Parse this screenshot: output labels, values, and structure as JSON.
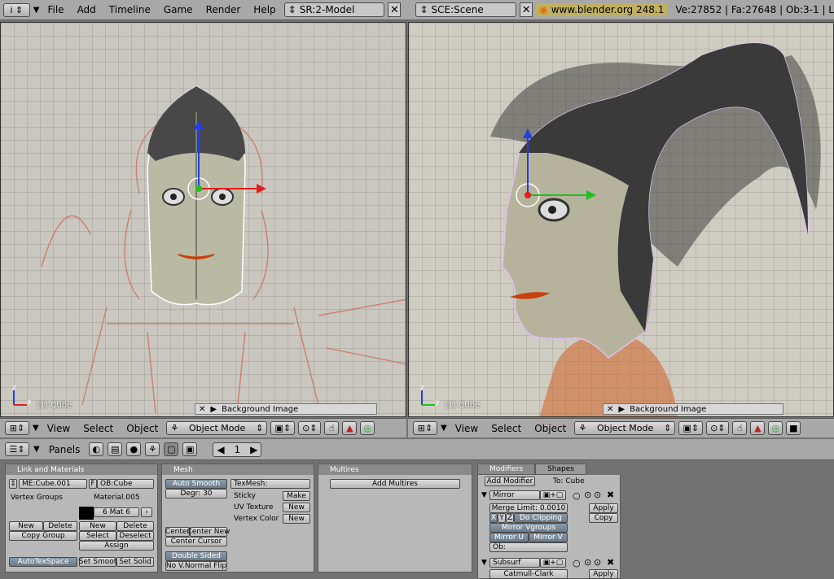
{
  "topbar": {
    "menus": [
      "File",
      "Add",
      "Timeline",
      "Game",
      "Render",
      "Help"
    ],
    "screen": "SR:2-Model",
    "scene": "SCE:Scene",
    "version": "www.blender.org 248.1",
    "stats": "Ve:27852 | Fa:27648 | Ob:3-1 | L"
  },
  "viewport_left": {
    "label": "(1) Cube",
    "bg_label": "Background Image",
    "axis_x": "x",
    "axis_z": "z"
  },
  "viewport_right": {
    "label": "(1) Cube",
    "bg_label": "Background Image",
    "axis_y": "y",
    "axis_z": "z"
  },
  "header": {
    "view": "View",
    "select": "Select",
    "object": "Object",
    "mode": "Object Mode"
  },
  "buttons_header": {
    "panels": "Panels",
    "frame": "1"
  },
  "link_materials": {
    "title": "Link and Materials",
    "mesh_name": "ME:Cube.001",
    "f": "F",
    "ob_name": "OB:Cube",
    "vertex_groups": "Vertex Groups",
    "material": "Material.005",
    "mat_num": "6 Mat 6",
    "new1": "New",
    "delete1": "Delete",
    "copy_group": "Copy Group",
    "new2": "New",
    "delete2": "Delete",
    "select": "Select",
    "deselect": "Deselect",
    "assign": "Assign",
    "autotex": "AutoTexSpace",
    "set_smooth": "Set Smoot",
    "set_solid": "Set Solid"
  },
  "mesh": {
    "title": "Mesh",
    "auto_smooth": "Auto Smooth",
    "degr": "Degr: 30",
    "texmesh": "TexMesh:",
    "sticky": "Sticky",
    "make": "Make",
    "uv_texture": "UV Texture",
    "new_uv": "New",
    "vertex_color": "Vertex Color",
    "new_vc": "New",
    "center": "Center",
    "center_new": "Center New",
    "center_cursor": "Center Cursor",
    "double_sided": "Double Sided",
    "no_vnormal": "No V.Normal Flip"
  },
  "multires": {
    "title": "Multires",
    "add": "Add Multires"
  },
  "modifiers": {
    "tab_modifiers": "Modifiers",
    "tab_shapes": "Shapes",
    "add": "Add Modifier",
    "to": "To: Cube",
    "mirror": "Mirror",
    "merge_limit": "Merge Limit: 0.0010",
    "x": "X",
    "y": "Y",
    "z": "Z",
    "do_clipping": "Do Clipping",
    "mirror_vgroups": "Mirror Vgroups",
    "mirror_u": "Mirror U",
    "mirror_v": "Mirror V",
    "ob": "Ob:",
    "apply": "Apply",
    "copy": "Copy",
    "subsurf": "Subsurf",
    "catmull": "Catmull-Clark",
    "apply2": "Apply"
  }
}
